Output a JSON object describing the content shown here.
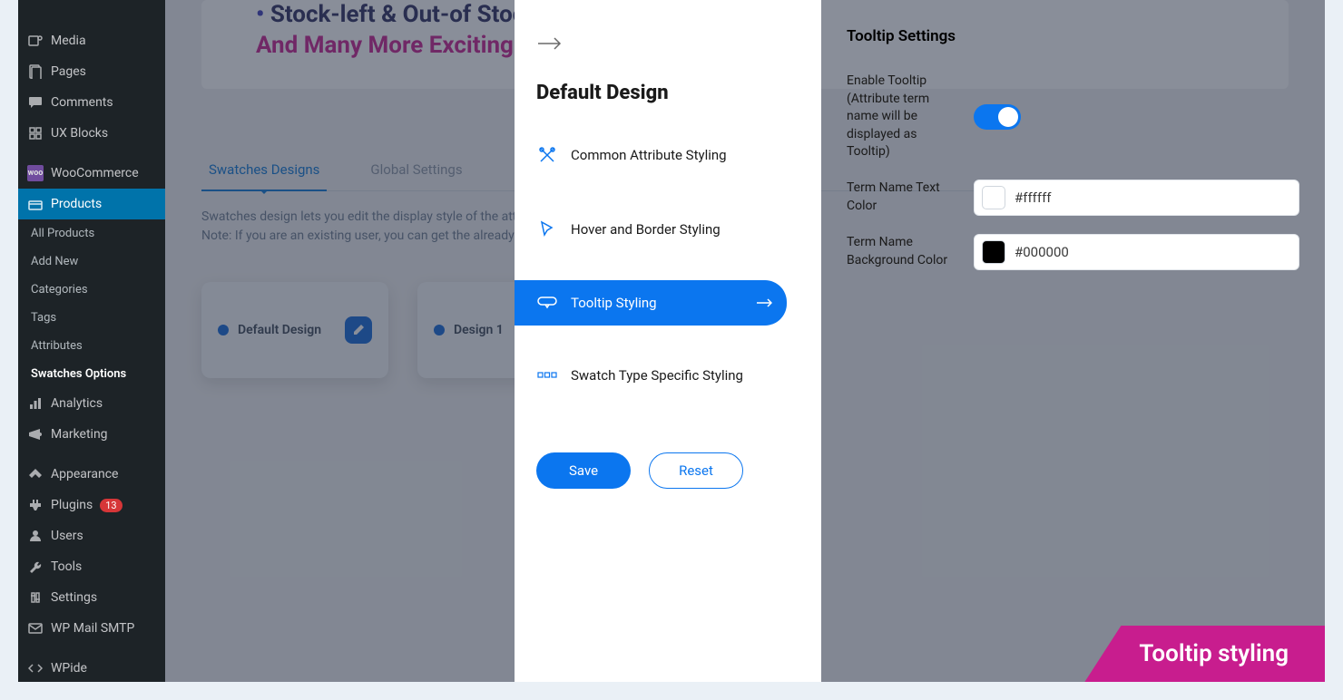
{
  "sidebar": {
    "media": "Media",
    "pages": "Pages",
    "comments": "Comments",
    "ux_blocks": "UX Blocks",
    "woocommerce": "WooCommerce",
    "products": "Products",
    "all_products": "All Products",
    "add_new": "Add New",
    "categories": "Categories",
    "tags": "Tags",
    "attributes": "Attributes",
    "swatches_options": "Swatches Options",
    "analytics": "Analytics",
    "marketing": "Marketing",
    "appearance": "Appearance",
    "plugins": "Plugins",
    "plugins_count": "13",
    "users": "Users",
    "tools": "Tools",
    "settings": "Settings",
    "wp_mail": "WP Mail SMTP",
    "wpide": "WPide"
  },
  "banner": {
    "line1a": "Stock-left & Out-of Stock A",
    "line2": "And Many More Exciting Fe"
  },
  "tabs": {
    "swatches_designs": "Swatches Designs",
    "global_settings": "Global Settings"
  },
  "help": {
    "line1": "Swatches design lets you edit the display style of the attribute, suc",
    "line2": "Note: If you are an existing user, you can get the already created de"
  },
  "cards": {
    "default": "Default Design",
    "design1": "Design 1"
  },
  "panel_mid": {
    "title": "Default Design",
    "common": "Common Attribute Styling",
    "hover": "Hover and Border Styling",
    "tooltip": "Tooltip Styling",
    "specific": "Swatch Type Specific Styling",
    "save": "Save",
    "reset": "Reset"
  },
  "panel_right": {
    "title": "Tooltip Settings",
    "enable_tooltip": "Enable Tooltip (Attribute term name will be displayed as Tooltip)",
    "text_color_label": "Term Name Text Color",
    "text_color_value": "#ffffff",
    "bg_color_label": "Term Name Background Color",
    "bg_color_value": "#000000"
  },
  "ribbon": "Tooltip styling"
}
